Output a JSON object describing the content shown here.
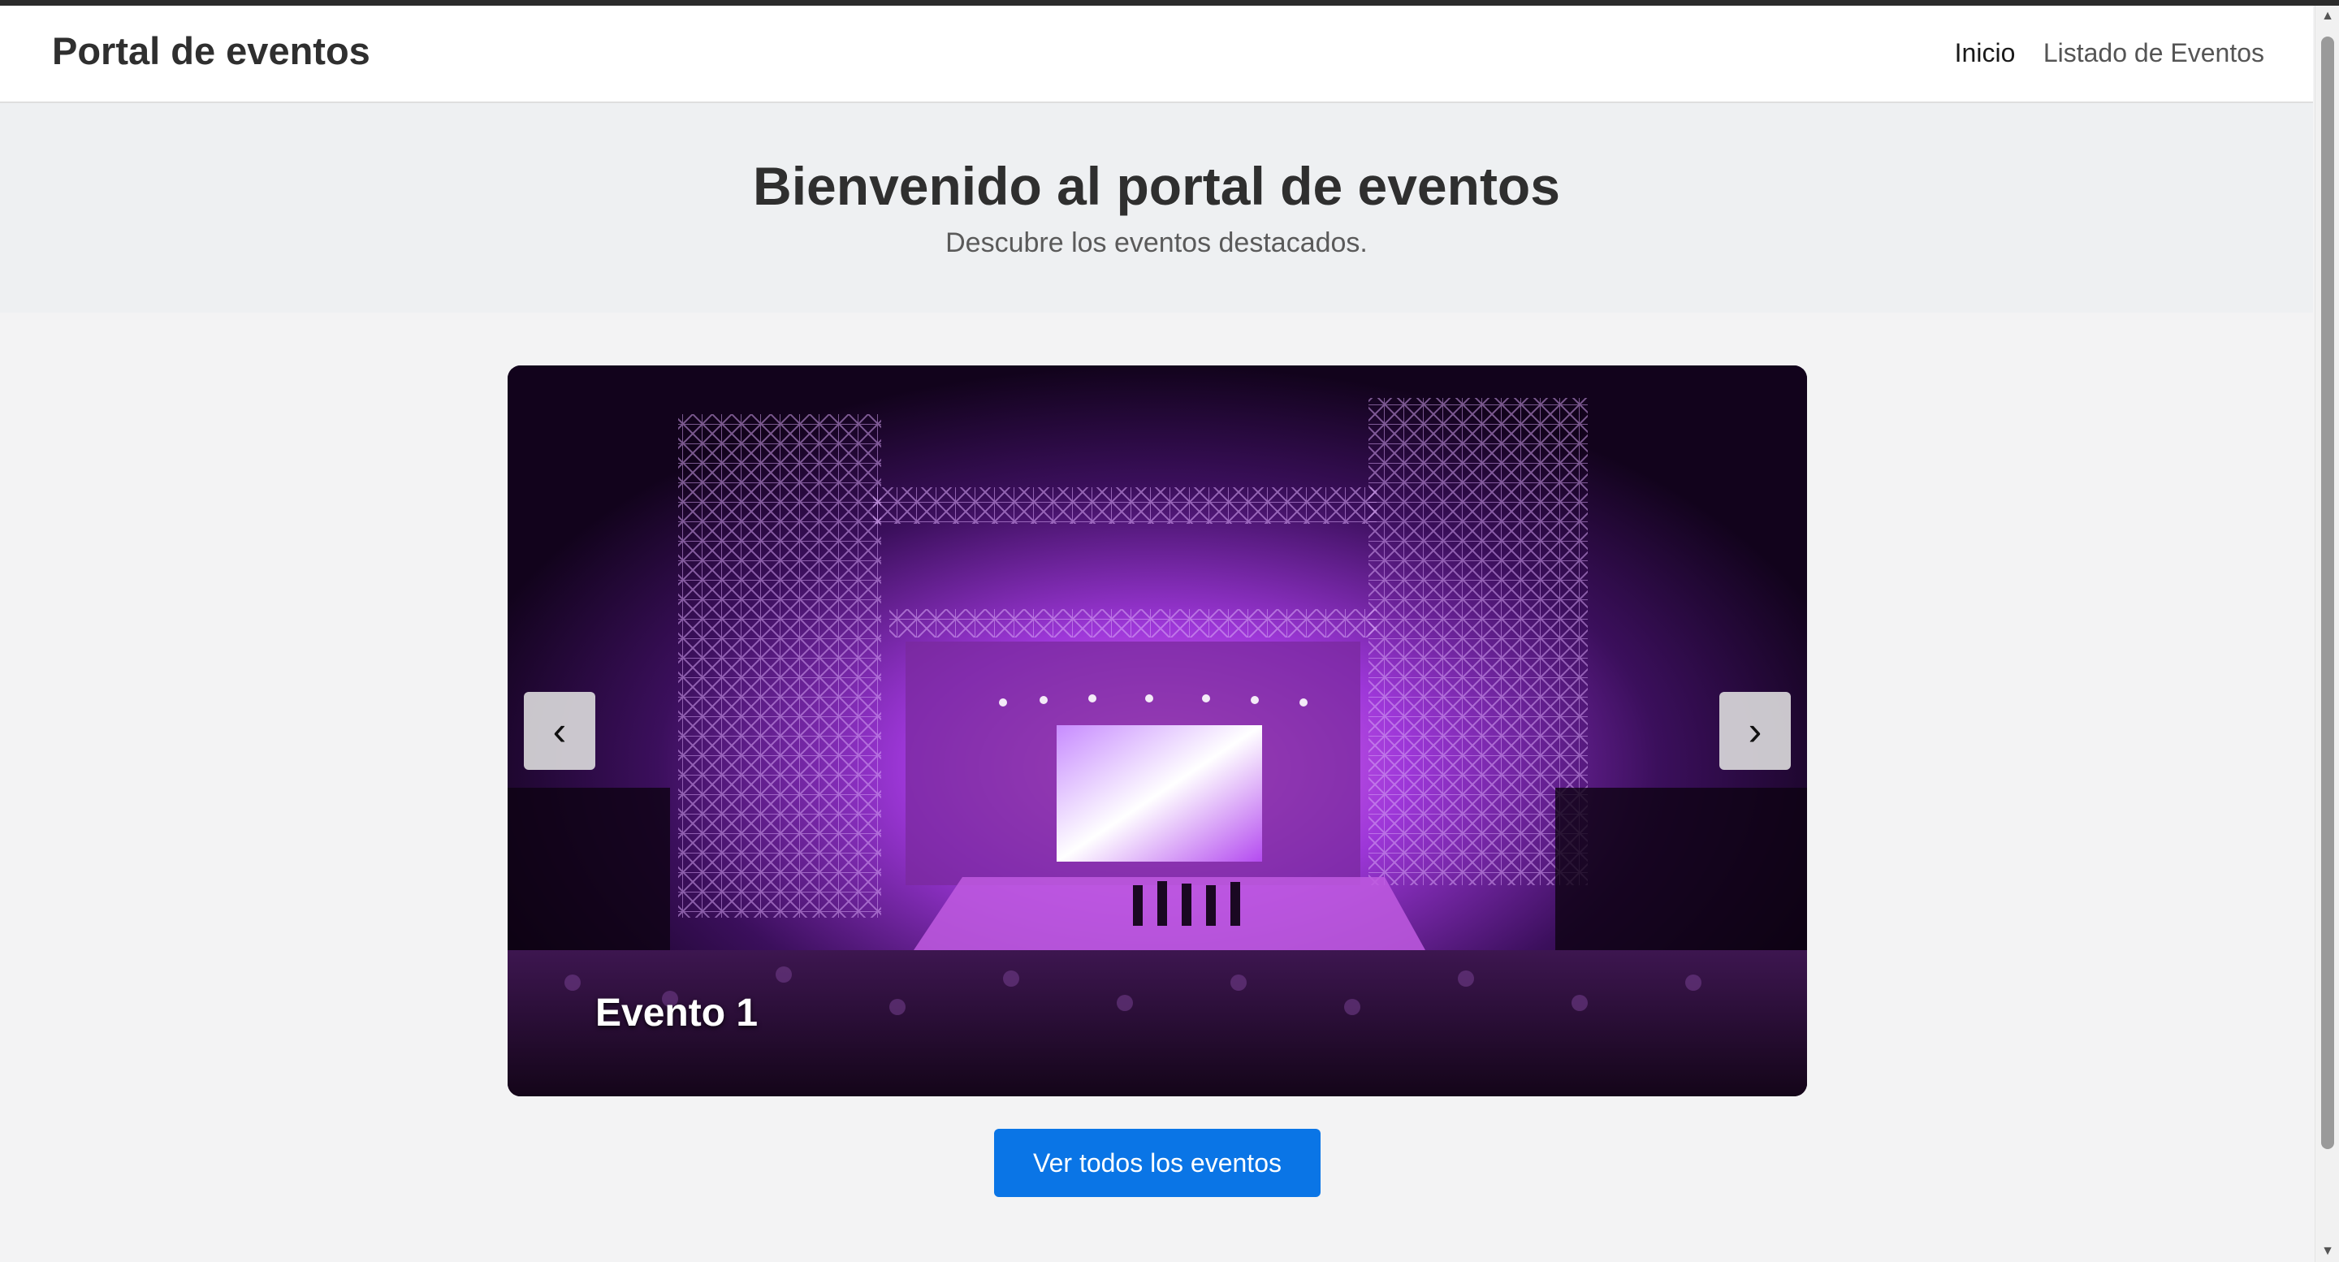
{
  "navbar": {
    "brand": "Portal de eventos",
    "links": [
      {
        "label": "Inicio",
        "active": true
      },
      {
        "label": "Listado de Eventos",
        "active": false
      }
    ]
  },
  "hero": {
    "title": "Bienvenido al portal de eventos",
    "subtitle": "Descubre los eventos destacados."
  },
  "carousel": {
    "current_caption": "Evento 1",
    "prev_icon": "‹",
    "next_icon": "›"
  },
  "cta": {
    "label": "Ver todos los eventos"
  },
  "colors": {
    "accent": "#0a75e6",
    "hero_background": "#eef0f2",
    "page_background": "#f3f3f4"
  }
}
